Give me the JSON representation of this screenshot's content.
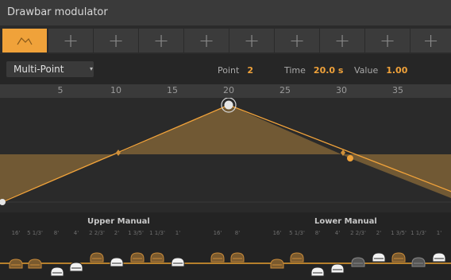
{
  "window": {
    "title": "Drawbar modulator"
  },
  "slots": {
    "icons": [
      "envelope-icon",
      "plus-icon",
      "plus-icon",
      "plus-icon",
      "plus-icon",
      "plus-icon",
      "plus-icon",
      "plus-icon",
      "plus-icon",
      "plus-icon"
    ],
    "plus_glyph": "+"
  },
  "toolbar": {
    "mode": "Multi-Point",
    "caret": "▾",
    "point_label": "Point",
    "point_value": "2",
    "time_label": "Time",
    "time_value": "20.0 s",
    "value_label": "Value",
    "value_value": "1.00"
  },
  "ruler": {
    "ticks": [
      "5",
      "10",
      "15",
      "20",
      "25",
      "30",
      "35"
    ]
  },
  "envelope": {
    "points": [
      {
        "time": 0,
        "value": 0
      },
      {
        "time": 20,
        "value": 1.0
      },
      {
        "time": 40,
        "value": 0.1
      }
    ],
    "baseline_value": 0.5,
    "selected_point": 2,
    "accent": "#f0a23a"
  },
  "upper_manual": {
    "label": "Upper Manual",
    "footages": [
      "16'",
      "5 1/3'",
      "8'",
      "4'",
      "2 2/3'",
      "2'",
      "1 3/5'",
      "1 1/3'",
      "1'"
    ],
    "pedal_footages": [
      "16'",
      "8'"
    ]
  },
  "lower_manual": {
    "label": "Lower Manual",
    "footages": [
      "16'",
      "5 1/3'",
      "8'",
      "4'",
      "2 2/3'",
      "2'",
      "1 3/5'",
      "1 1/3'",
      "1'"
    ]
  }
}
